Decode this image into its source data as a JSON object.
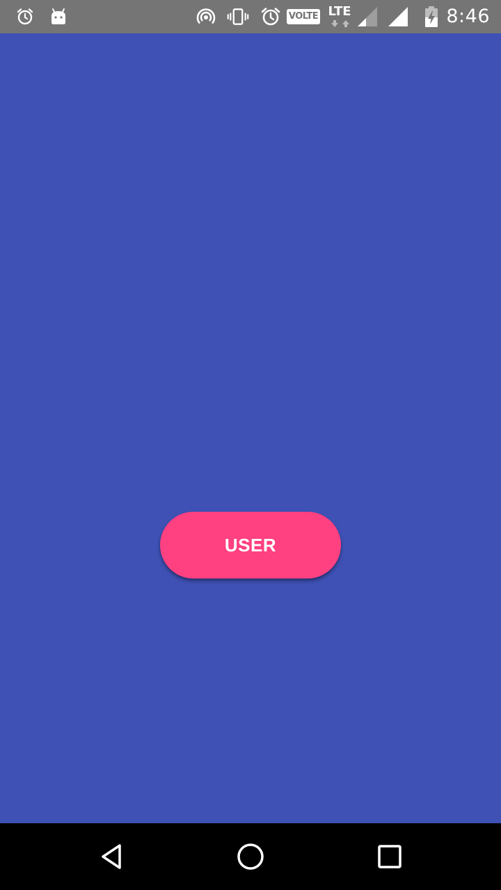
{
  "status_bar": {
    "time": "8:46",
    "volte_label": "VOLTE",
    "network_label": "LTE",
    "icons": [
      "alarm-clock-icon",
      "android-icon",
      "hotspot-icon",
      "vibrate-icon",
      "alarm-icon",
      "signal-icon",
      "signal-full-icon",
      "battery-charging-icon"
    ],
    "background_color": "#757575"
  },
  "main": {
    "background_color": "#3f51b5",
    "user_button": {
      "label": "USER",
      "color": "#ff4081"
    }
  },
  "nav_bar": {
    "buttons": [
      "back-icon",
      "home-icon",
      "recents-icon"
    ],
    "background_color": "#000000"
  }
}
